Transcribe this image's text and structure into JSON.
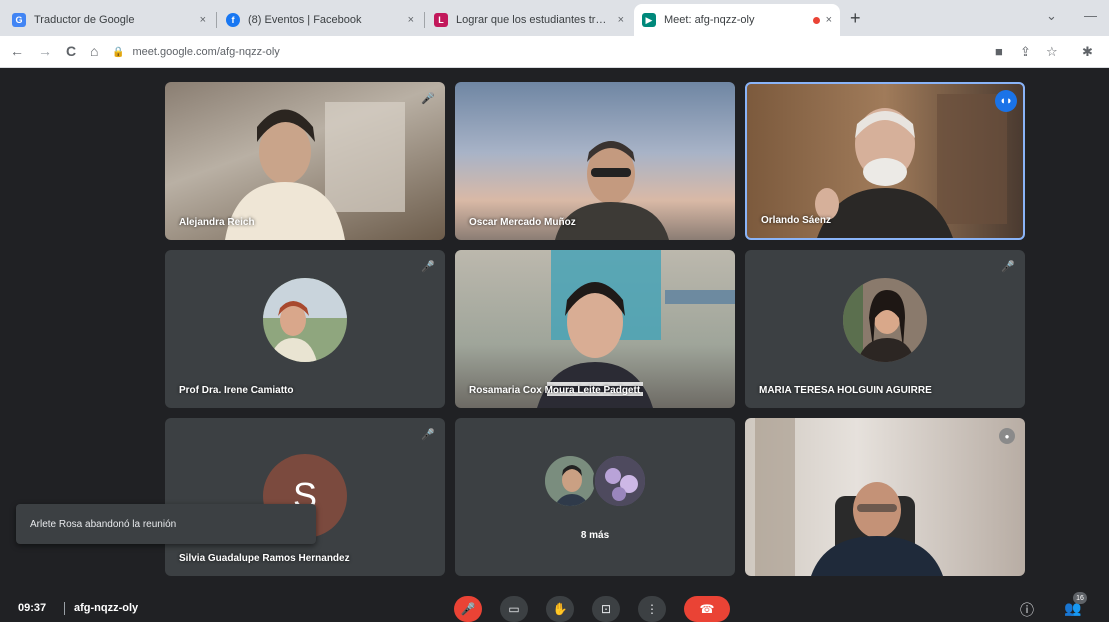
{
  "browser": {
    "tabs": [
      {
        "title": "Traductor de Google",
        "close": "×",
        "favicon_color": "#4285f4",
        "favicon": "translate-icon",
        "glyph": "G"
      },
      {
        "title": "(8) Eventos | Facebook",
        "close": "×",
        "favicon_color": "#1877f2",
        "favicon": "facebook-icon",
        "glyph": "f"
      },
      {
        "title": "Lograr que los estudiantes trans",
        "close": "×",
        "favicon_color": "#c2185b",
        "favicon": "page-icon",
        "glyph": "L"
      },
      {
        "title": "Meet: afg-nqzz-oly",
        "close": "×",
        "favicon_color": "#00897b",
        "favicon": "meet-icon",
        "glyph": "▶"
      }
    ],
    "new_tab": "+",
    "minimize": "—",
    "dropdown": "⌄",
    "back": "←",
    "forward": "→",
    "reload": "C",
    "home": "⌂",
    "url": "meet.google.com/afg-nqzz-oly",
    "lock": "🔒",
    "ext_camera": "■",
    "ext_share": "⇪",
    "ext_star": "☆",
    "ext_puzzle": "✱"
  },
  "tiles": [
    {
      "name": "Alejandra Reich",
      "mic": "🎤",
      "kind": "video"
    },
    {
      "name": "Oscar Mercado Muñoz",
      "mic": "",
      "kind": "video"
    },
    {
      "name": "Orlando Sáenz",
      "mic": "",
      "kind": "video",
      "speaking": "◖◗"
    },
    {
      "name": "Prof Dra. Irene Camiatto",
      "mic": "🎤",
      "kind": "photo"
    },
    {
      "name": "Rosamaria Cox Moura Leite Padgett",
      "mic": "",
      "kind": "video"
    },
    {
      "name": "MARIA TERESA HOLGUIN AGUIRRE",
      "mic": "🎤",
      "kind": "photo"
    },
    {
      "name": "Silvia Guadalupe Ramos Hernandez",
      "mic": "🎤",
      "kind": "letter",
      "letter": "S"
    },
    {
      "name": "8 más",
      "mic": "",
      "kind": "more"
    },
    {
      "name": "",
      "mic": "●",
      "kind": "video"
    }
  ],
  "toast": "Arlete Rosa abandonó la reunión",
  "bottom": {
    "time": "09:37",
    "meeting_code": "afg-nqzz-oly",
    "mic": "🎤",
    "camera": "▭",
    "hand": "✋",
    "present": "⊡",
    "more": "⋮",
    "hangup": "☎",
    "info": "ⓘ",
    "people": "👥",
    "people_count": "16"
  },
  "colors": {
    "accent": "#8ab4f8",
    "danger": "#ea4335",
    "tile_bg": "#3c4043"
  }
}
